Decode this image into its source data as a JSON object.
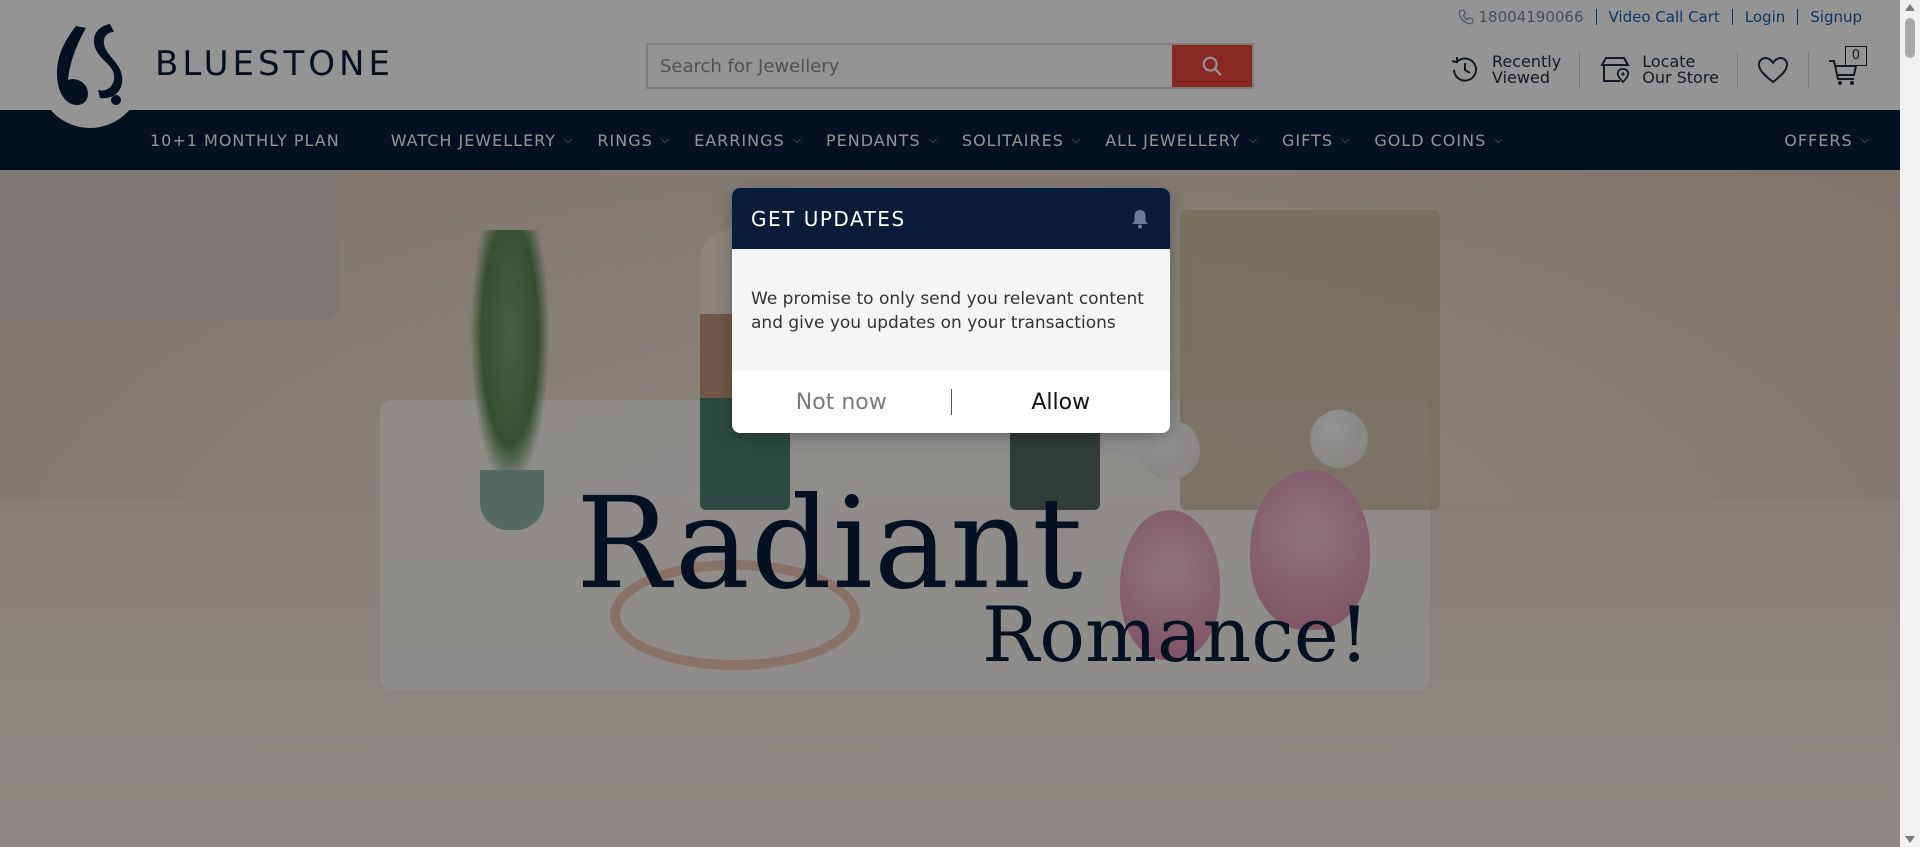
{
  "brand": {
    "name": "BLUESTONE"
  },
  "toplinks": {
    "phone": "18004190066",
    "video_call": "Video Call Cart",
    "login": "Login",
    "signup": "Signup"
  },
  "search": {
    "placeholder": "Search for Jewellery"
  },
  "header_icons": {
    "recently_line1": "Recently",
    "recently_line2": "Viewed",
    "locate_line1": "Locate",
    "locate_line2": "Our Store",
    "cart_count": "0"
  },
  "nav": {
    "items": [
      {
        "label": "10+1 MONTHLY PLAN",
        "dropdown": false
      },
      {
        "label": "WATCH JEWELLERY",
        "dropdown": true
      },
      {
        "label": "RINGS",
        "dropdown": true
      },
      {
        "label": "EARRINGS",
        "dropdown": true
      },
      {
        "label": "PENDANTS",
        "dropdown": true
      },
      {
        "label": "SOLITAIRES",
        "dropdown": true
      },
      {
        "label": "ALL JEWELLERY",
        "dropdown": true
      },
      {
        "label": "GIFTS",
        "dropdown": true
      },
      {
        "label": "GOLD COINS",
        "dropdown": true
      }
    ],
    "offers": "OFFERS"
  },
  "hero": {
    "line1": "Radiant",
    "line2": "Romance!"
  },
  "modal": {
    "title": "GET UPDATES",
    "body": "We promise to only send you relevant content and give you updates on your transactions",
    "not_now": "Not now",
    "allow": "Allow"
  },
  "colors": {
    "navy": "#0a1c3a",
    "search_button": "#e8463d",
    "link_blue": "#1f5b9e"
  }
}
